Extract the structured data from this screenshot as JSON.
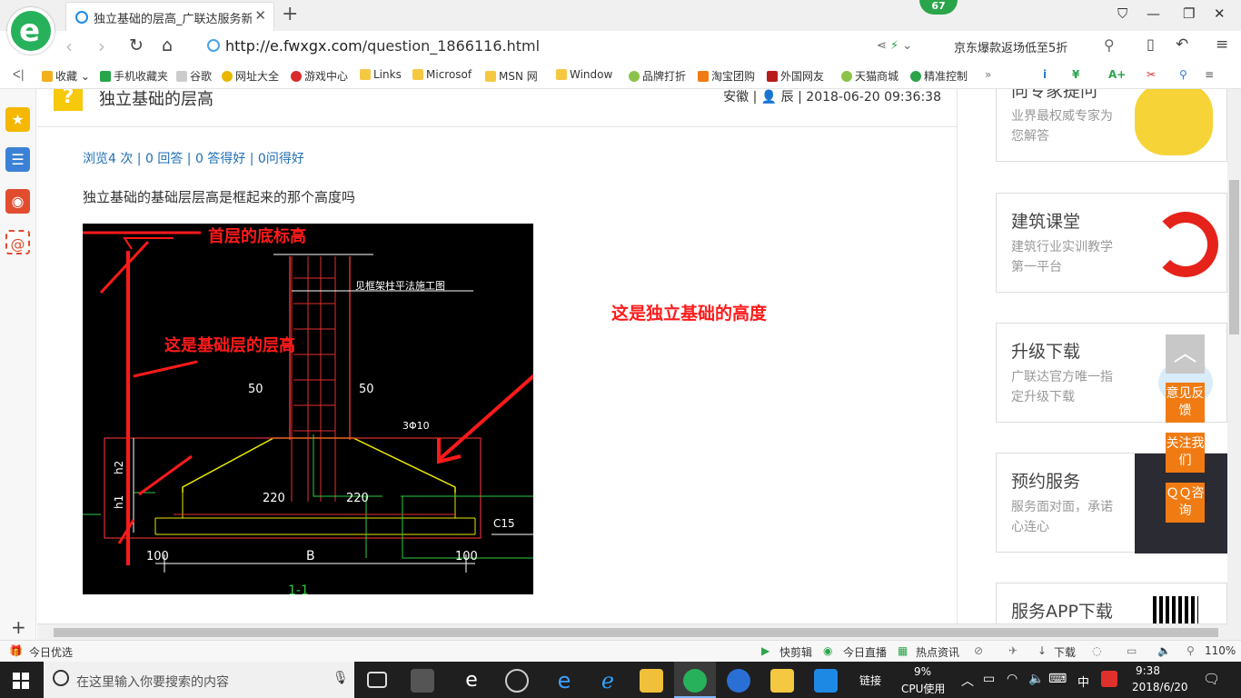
{
  "browser": {
    "tab_title": "独立基础的层高_广联达服务新干线",
    "update_badge": "67",
    "url_host": "http://e.fwxgx.com",
    "url_path": "/question_1866116.html",
    "promo_text": "京东爆款返场低至5折"
  },
  "bookmarks": [
    {
      "label": "收藏",
      "color": "#f2b01e"
    },
    {
      "label": "手机收藏夹",
      "color": "#2aa54a"
    },
    {
      "label": "谷歌",
      "color": "#bbb"
    },
    {
      "label": "网址大全",
      "color": "#e8b600"
    },
    {
      "label": "游戏中心",
      "color": "#d92b2b"
    },
    {
      "label": "Links",
      "color": "#f5c842"
    },
    {
      "label": "Microsof",
      "color": "#f5c842"
    },
    {
      "label": "MSN 网",
      "color": "#f5c842"
    },
    {
      "label": "Window",
      "color": "#f5c842"
    },
    {
      "label": "品牌打折",
      "color": "#8bc34a"
    },
    {
      "label": "淘宝团购",
      "color": "#f07b13"
    },
    {
      "label": "外国网友",
      "color": "#b71c1c"
    },
    {
      "label": "天猫商城",
      "color": "#8bc34a"
    },
    {
      "label": "精准控制",
      "color": "#2aa54a"
    }
  ],
  "question": {
    "title": "独立基础的层高",
    "region": "安徽",
    "user": "辰",
    "datetime": "2018-06-20 09:36:38",
    "stats": "浏览4 次 | 0 回答 | 0 答得好 | 0问得好",
    "text": "独立基础的基础层层高是框起来的那个高度吗"
  },
  "drawing": {
    "annot_top": "首层的底标高",
    "annot_left": "这是基础层的层高",
    "annot_right": "这是独立基础的高度",
    "dim_50_left": "50",
    "dim_50_right": "50",
    "rebar": "3Φ10",
    "dim_220_left": "220",
    "dim_220_right": "220",
    "dim_100_left": "100",
    "dim_100_right": "100",
    "dim_b": "B",
    "c15": "C15",
    "h2": "h2",
    "h1": "h1",
    "section": "1-1",
    "note": "见框架柱平法施工图"
  },
  "right_cards": [
    {
      "title": "向专家提问",
      "sub": "业界最权威专家为您解答"
    },
    {
      "title": "建筑课堂",
      "sub": "建筑行业实训教学第一平台"
    },
    {
      "title": "升级下载",
      "sub": "广联达官方唯一指定升级下载"
    },
    {
      "title": "预约服务",
      "sub": "服务面对面，承诺心连心"
    },
    {
      "title": "服务APP下载",
      "sub": ""
    }
  ],
  "float_buttons": {
    "feedback": "意见反馈",
    "follow": "关注我们",
    "qq": "ＱＱ咨询"
  },
  "statusbar": {
    "left": "今日优选",
    "kuaijianji": "快剪辑",
    "live": "今日直播",
    "news": "热点资讯",
    "download": "下载",
    "zoom": "110%"
  },
  "taskbar": {
    "search_placeholder": "在这里输入你要搜索的内容",
    "links": "链接",
    "cpu_percent": "9%",
    "cpu_label": "CPU使用",
    "ime": "中",
    "time": "9:38",
    "date": "2018/6/20"
  }
}
